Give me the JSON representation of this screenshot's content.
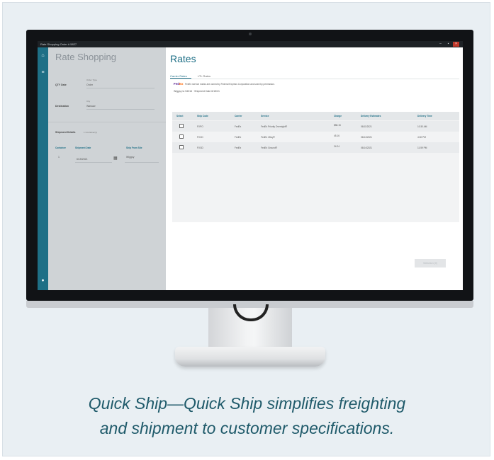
{
  "window": {
    "title": "Rate Shopping Order # 5827"
  },
  "left_panel": {
    "title": "Rate Shopping",
    "qty_date": {
      "label": "QTY Date",
      "small_label": "Order Type",
      "value": "Order"
    },
    "destination": {
      "label": "Destination",
      "small_label": "City",
      "value": "Warsaw"
    },
    "shipment_details": {
      "label": "Shipment Details",
      "sub": "1 Container(s)"
    },
    "columns": [
      "Container",
      "Shipment Date",
      "Ship From Site"
    ],
    "row": {
      "container": "1",
      "date": "6/15/2021",
      "site": "Wiggsy"
    }
  },
  "main": {
    "title": "Rates",
    "tabs": [
      "Carrier Rates",
      "LTL Rates"
    ],
    "fedex": {
      "logo_fed": "Fed",
      "logo_ex": "Ex",
      "note": "FedEx service marks are owned by Federal Express Corporation and used by permission."
    },
    "ship_info": "Wiggsy to 54016 · Shipment Date 6/15/21",
    "table": {
      "headers": [
        "Select",
        "Ship Code",
        "Carrier",
        "Service",
        "Charge",
        "Delivery Estimates",
        "Delivery Time"
      ],
      "rows": [
        {
          "code": "FXPO",
          "carrier": "FedEx",
          "service": "FedEx Priority Overnight®",
          "charge": "$58.15",
          "date": "06/11/2021",
          "time": "10:30 AM"
        },
        {
          "code": "FXCD",
          "carrier": "FedEx",
          "service": "FedEx 2Day®",
          "charge": "45.16",
          "date": "06/14/2021",
          "time": "4:30 PM"
        },
        {
          "code": "FXGD",
          "carrier": "FedEx",
          "service": "FedEx Ground®",
          "charge": "24.24",
          "date": "06/14/2021",
          "time": "11:59 PM"
        }
      ]
    },
    "save_button": "Selection (0)"
  },
  "caption": {
    "line1": "Quick Ship—Quick Ship simplifies freighting",
    "line2": "and shipment to customer specifications."
  }
}
